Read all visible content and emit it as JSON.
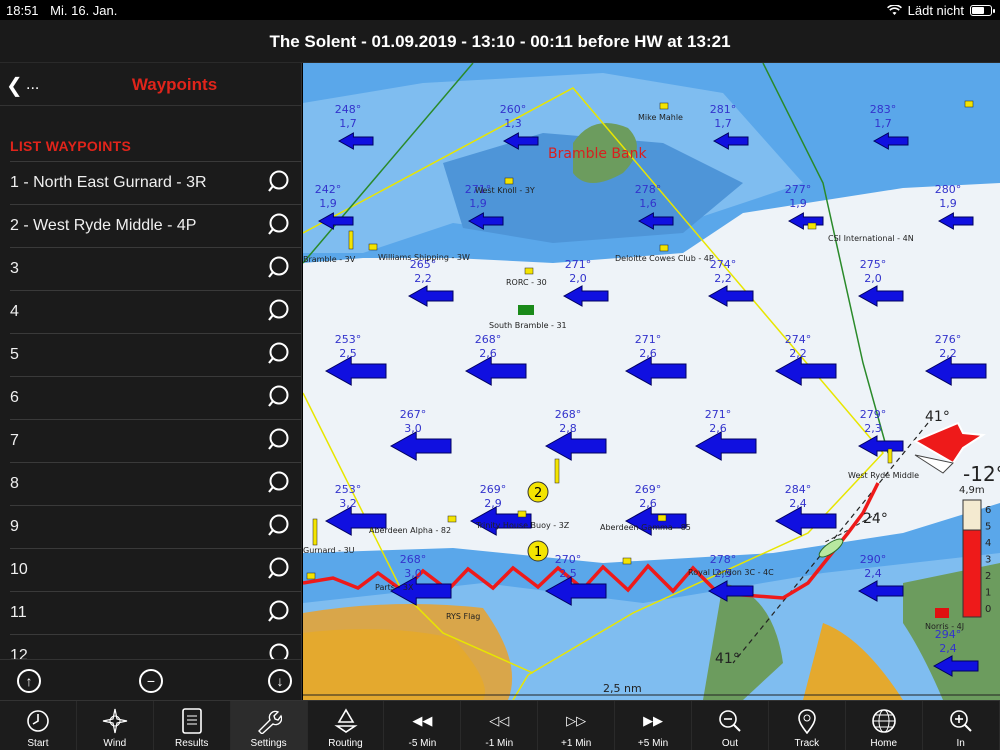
{
  "status": {
    "time": "18:51",
    "date": "Mi. 16. Jan.",
    "battery_text": "Lädt nicht"
  },
  "title": "The Solent - 01.09.2019 - 13:10 - 00:11 before HW at 13:21",
  "sidebar": {
    "back_label": "...",
    "title": "Waypoints",
    "section": "LIST WAYPOINTS",
    "items": [
      {
        "label": "1 - North East Gurnard - 3R"
      },
      {
        "label": "2 - West Ryde Middle - 4P"
      },
      {
        "label": "3"
      },
      {
        "label": "4"
      },
      {
        "label": "5"
      },
      {
        "label": "6"
      },
      {
        "label": "7"
      },
      {
        "label": "8"
      },
      {
        "label": "9"
      },
      {
        "label": "10"
      },
      {
        "label": "11"
      },
      {
        "label": "12"
      }
    ]
  },
  "map": {
    "place_labels": [
      "Bramble Bank",
      "West Knoll - 3Y",
      "RORC - 30",
      "South Bramble - 31",
      "Deloitte Cowes Club - 4P",
      "CSI International - 4N",
      "Aberdeen Alpha - 82",
      "Trinity House Buoy - 3Z",
      "Aberdeen Gamma - 85",
      "Royal London 3C - 4C",
      "West Ryde Middle",
      "Norris - 4J",
      "RYS Flag",
      "Mike Mahle",
      "Bramble - 3V",
      "Williams Shipping - 3W",
      "Gurnard - 3U",
      "Parts - 3X"
    ],
    "scale_text": "2,5 nm",
    "wind_angle_top": "41°",
    "wind_angle_bottom": "41°",
    "course_angle": "24°",
    "heading_big": "-12°",
    "depth_title": "4,9m",
    "depth_scale": [
      "6",
      "5",
      "4",
      "3",
      "2",
      "1",
      "0"
    ],
    "currents": [
      {
        "dir": "248°",
        "spd": "1,7"
      },
      {
        "dir": "260°",
        "spd": "1,3"
      },
      {
        "dir": "281°",
        "spd": "1,7"
      },
      {
        "dir": "283°",
        "spd": "1,7"
      },
      {
        "dir": "242°",
        "spd": "1,9"
      },
      {
        "dir": "271°",
        "spd": "1,9"
      },
      {
        "dir": "278°",
        "spd": "1,6"
      },
      {
        "dir": "277°",
        "spd": "1,9"
      },
      {
        "dir": "280°",
        "spd": "1,9"
      },
      {
        "dir": "265°",
        "spd": "2,2"
      },
      {
        "dir": "271°",
        "spd": "2,0"
      },
      {
        "dir": "274°",
        "spd": "2,2"
      },
      {
        "dir": "275°",
        "spd": "2,0"
      },
      {
        "dir": "253°",
        "spd": "2,5"
      },
      {
        "dir": "268°",
        "spd": "2,6"
      },
      {
        "dir": "271°",
        "spd": "2,6"
      },
      {
        "dir": "274°",
        "spd": "2,2"
      },
      {
        "dir": "276°",
        "spd": "2,2"
      },
      {
        "dir": "267°",
        "spd": "3,0"
      },
      {
        "dir": "268°",
        "spd": "2,8"
      },
      {
        "dir": "271°",
        "spd": "2,6"
      },
      {
        "dir": "279°",
        "spd": "2,3"
      },
      {
        "dir": "253°",
        "spd": "3,2"
      },
      {
        "dir": "269°",
        "spd": "2,9"
      },
      {
        "dir": "269°",
        "spd": "2,6"
      },
      {
        "dir": "284°",
        "spd": "2,4"
      },
      {
        "dir": "268°",
        "spd": "3,0"
      },
      {
        "dir": "270°",
        "spd": "2,5"
      },
      {
        "dir": "278°",
        "spd": "2,5"
      },
      {
        "dir": "290°",
        "spd": "2,4"
      },
      {
        "dir": "294°",
        "spd": "2,4"
      }
    ]
  },
  "toolbar": [
    {
      "label": "Start",
      "icon": "clock-icon"
    },
    {
      "label": "Wind",
      "icon": "compass-rose-icon"
    },
    {
      "label": "Results",
      "icon": "tablet-icon"
    },
    {
      "label": "Settings",
      "icon": "wrench-icon"
    },
    {
      "label": "Routing",
      "icon": "recycle-icon"
    },
    {
      "label": "-5 Min",
      "icon": "fast-backward-icon"
    },
    {
      "label": "-1 Min",
      "icon": "backward-icon"
    },
    {
      "label": "+1 Min",
      "icon": "forward-icon"
    },
    {
      "label": "+5 Min",
      "icon": "fast-forward-icon"
    },
    {
      "label": "Out",
      "icon": "zoom-out-icon"
    },
    {
      "label": "Track",
      "icon": "map-pin-icon"
    },
    {
      "label": "Home",
      "icon": "globe-icon"
    },
    {
      "label": "In",
      "icon": "zoom-in-icon"
    }
  ]
}
